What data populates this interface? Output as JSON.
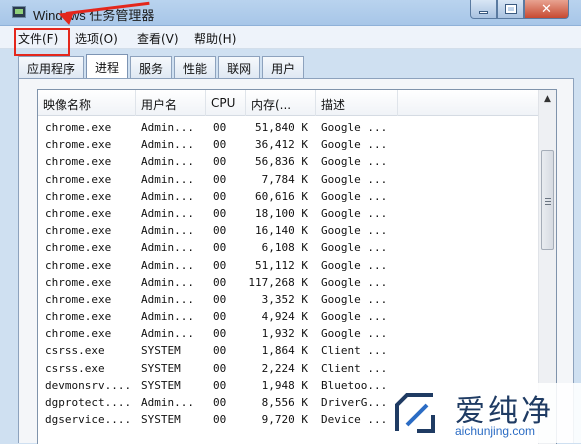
{
  "window": {
    "title": "Windows 任务管理器",
    "min_label": "",
    "max_label": "",
    "close_label": "✕"
  },
  "menu": {
    "file": "文件(F)",
    "options": "选项(O)",
    "view": "查看(V)",
    "help": "帮助(H)"
  },
  "tabs": [
    {
      "label": "应用程序"
    },
    {
      "label": "进程"
    },
    {
      "label": "服务"
    },
    {
      "label": "性能"
    },
    {
      "label": "联网"
    },
    {
      "label": "用户"
    }
  ],
  "active_tab": "进程",
  "columns": {
    "name": "映像名称",
    "user": "用户名",
    "cpu": "CPU",
    "mem": "内存(...",
    "desc": "描述"
  },
  "processes": [
    {
      "name": "chrome.exe",
      "user": "Admin...",
      "cpu": "00",
      "mem": "51,840 K",
      "desc": "Google ..."
    },
    {
      "name": "chrome.exe",
      "user": "Admin...",
      "cpu": "00",
      "mem": "36,412 K",
      "desc": "Google ..."
    },
    {
      "name": "chrome.exe",
      "user": "Admin...",
      "cpu": "00",
      "mem": "56,836 K",
      "desc": "Google ..."
    },
    {
      "name": "chrome.exe",
      "user": "Admin...",
      "cpu": "00",
      "mem": "7,784 K",
      "desc": "Google ..."
    },
    {
      "name": "chrome.exe",
      "user": "Admin...",
      "cpu": "00",
      "mem": "60,616 K",
      "desc": "Google ..."
    },
    {
      "name": "chrome.exe",
      "user": "Admin...",
      "cpu": "00",
      "mem": "18,100 K",
      "desc": "Google ..."
    },
    {
      "name": "chrome.exe",
      "user": "Admin...",
      "cpu": "00",
      "mem": "16,140 K",
      "desc": "Google ..."
    },
    {
      "name": "chrome.exe",
      "user": "Admin...",
      "cpu": "00",
      "mem": "6,108 K",
      "desc": "Google ..."
    },
    {
      "name": "chrome.exe",
      "user": "Admin...",
      "cpu": "00",
      "mem": "51,112 K",
      "desc": "Google ..."
    },
    {
      "name": "chrome.exe",
      "user": "Admin...",
      "cpu": "00",
      "mem": "117,268 K",
      "desc": "Google ..."
    },
    {
      "name": "chrome.exe",
      "user": "Admin...",
      "cpu": "00",
      "mem": "3,352 K",
      "desc": "Google ..."
    },
    {
      "name": "chrome.exe",
      "user": "Admin...",
      "cpu": "00",
      "mem": "4,924 K",
      "desc": "Google ..."
    },
    {
      "name": "chrome.exe",
      "user": "Admin...",
      "cpu": "00",
      "mem": "1,932 K",
      "desc": "Google ..."
    },
    {
      "name": "csrss.exe",
      "user": "SYSTEM",
      "cpu": "00",
      "mem": "1,864 K",
      "desc": "Client ..."
    },
    {
      "name": "csrss.exe",
      "user": "SYSTEM",
      "cpu": "00",
      "mem": "2,224 K",
      "desc": "Client ..."
    },
    {
      "name": "devmonsrv....",
      "user": "SYSTEM",
      "cpu": "00",
      "mem": "1,948 K",
      "desc": "Bluetoo..."
    },
    {
      "name": "dgprotect....",
      "user": "Admin...",
      "cpu": "00",
      "mem": "8,556 K",
      "desc": "DriverG..."
    },
    {
      "name": "dgservice....",
      "user": "SYSTEM",
      "cpu": "00",
      "mem": "9,720 K",
      "desc": "Device ..."
    }
  ],
  "watermark": {
    "brand": "爱纯净",
    "url": "aichunjing.com"
  },
  "colors": {
    "annotation_red": "#e4271c",
    "titlebar_blue": "#b9d3ee"
  }
}
